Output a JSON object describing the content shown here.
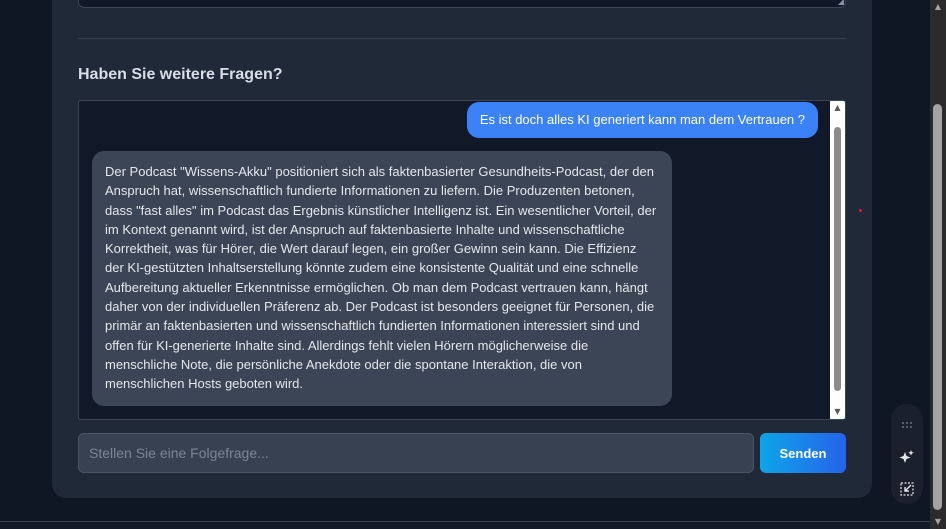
{
  "section": {
    "title": "Haben Sie weitere Fragen?"
  },
  "chat": {
    "messages": [
      {
        "role": "user",
        "text": "Es ist doch alles KI generiert kann man dem Vertrauen ?"
      },
      {
        "role": "assistant",
        "text": "Der Podcast \"Wissens-Akku\" positioniert sich als faktenbasierter Gesundheits-Podcast, der den Anspruch hat, wissenschaftlich fundierte Informationen zu liefern. Die Produzenten betonen, dass \"fast alles\" im Podcast das Ergebnis künstlicher Intelligenz ist. Ein wesentlicher Vorteil, der im Kontext genannt wird, ist der Anspruch auf faktenbasierte Inhalte und wissenschaftliche Korrektheit, was für Hörer, die Wert darauf legen, ein großer Gewinn sein kann. Die Effizienz der KI-gestützten Inhaltserstellung könnte zudem eine konsistente Qualität und eine schnelle Aufbereitung aktueller Erkenntnisse ermöglichen. Ob man dem Podcast vertrauen kann, hängt daher von der individuellen Präferenz ab. Der Podcast ist besonders geeignet für Personen, die primär an faktenbasierten und wissenschaftlich fundierten Informationen interessiert sind und offen für KI-generierte Inhalte sind. Allerdings fehlt vielen Hörern möglicherweise die menschliche Note, die persönliche Anekdote oder die spontane Interaktion, die von menschlichen Hosts geboten wird."
      }
    ]
  },
  "followup": {
    "placeholder": "Stellen Sie eine Folgefrage...",
    "value": "",
    "send_label": "Senden"
  },
  "toolbar": {
    "icons": [
      "grip-dots-icon",
      "sparkle-icon",
      "collapse-icon"
    ]
  },
  "colors": {
    "background": "#0f1624",
    "card": "#1f2937",
    "chat_background": "#111827",
    "user_bubble": "#3b82f6",
    "assistant_bubble": "#3b4555",
    "send_button_start": "#0ea5e9",
    "send_button_end": "#2563eb"
  }
}
